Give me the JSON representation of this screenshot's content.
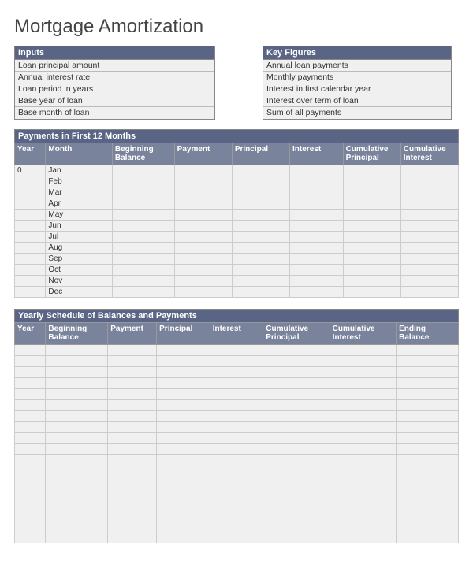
{
  "title": "Mortgage Amortization",
  "inputs": {
    "header": "Inputs",
    "rows": [
      "Loan principal amount",
      "Annual interest rate",
      "Loan period in years",
      "Base year of loan",
      "Base month of loan"
    ]
  },
  "keyFigures": {
    "header": "Key Figures",
    "rows": [
      "Annual loan payments",
      "Monthly payments",
      "Interest in first calendar year",
      "Interest over term of loan",
      "Sum of all payments"
    ]
  },
  "paymentsSection": {
    "header": "Payments in First 12 Months",
    "columns": [
      "Year",
      "Month",
      "Beginning Balance",
      "Payment",
      "Principal",
      "Interest",
      "Cumulative Principal",
      "Cumulative Interest"
    ],
    "rows": [
      {
        "year": "0",
        "month": "Jan"
      },
      {
        "year": "",
        "month": "Feb"
      },
      {
        "year": "",
        "month": "Mar"
      },
      {
        "year": "",
        "month": "Apr"
      },
      {
        "year": "",
        "month": "May"
      },
      {
        "year": "",
        "month": "Jun"
      },
      {
        "year": "",
        "month": "Jul"
      },
      {
        "year": "",
        "month": "Aug"
      },
      {
        "year": "",
        "month": "Sep"
      },
      {
        "year": "",
        "month": "Oct"
      },
      {
        "year": "",
        "month": "Nov"
      },
      {
        "year": "",
        "month": "Dec"
      }
    ]
  },
  "yearlySection": {
    "header": "Yearly Schedule of Balances and Payments",
    "columns": [
      "Year",
      "Beginning Balance",
      "Payment",
      "Principal",
      "Interest",
      "Cumulative Principal",
      "Cumulative Interest",
      "Ending Balance"
    ],
    "rowCount": 18
  }
}
